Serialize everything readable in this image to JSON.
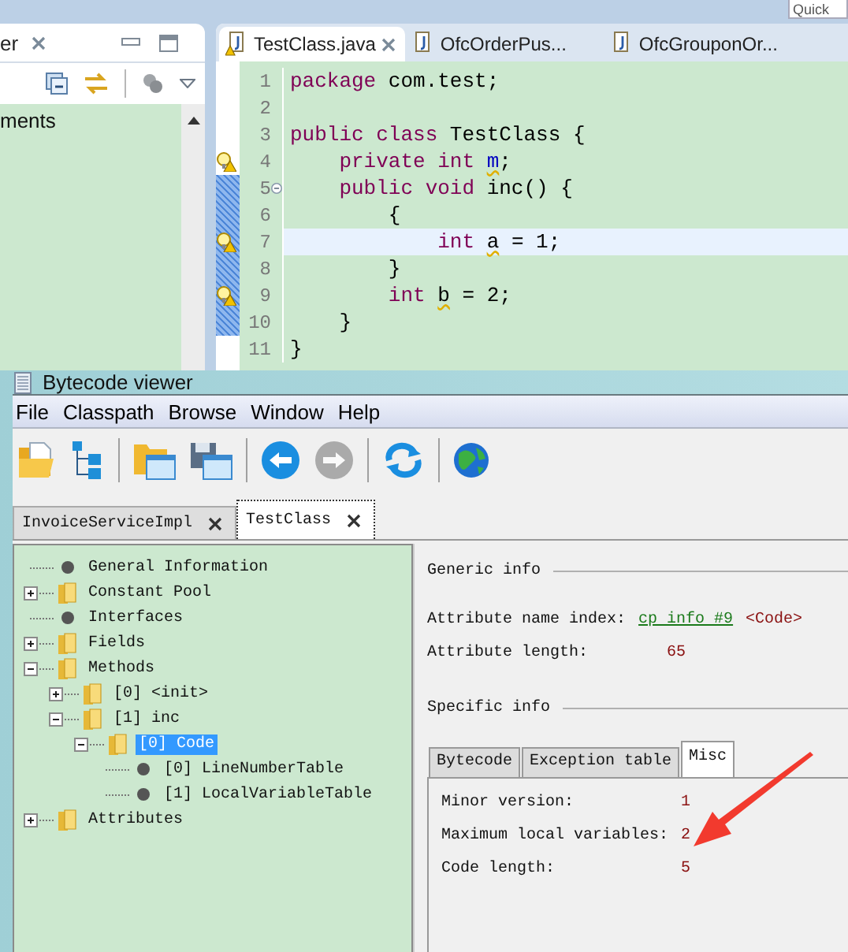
{
  "ide": {
    "quick_access": {
      "placeholder": "Quick"
    },
    "side_view": {
      "tab": {
        "label": "er"
      },
      "items": [
        "ments"
      ]
    },
    "editor_tabs": [
      {
        "label": "TestClass.java",
        "selected": true,
        "warning": true
      },
      {
        "label": "OfcOrderPus...",
        "selected": false,
        "warning": false
      },
      {
        "label": "OfcGrouponOr...",
        "selected": false,
        "warning": false
      }
    ],
    "code_lines": [
      {
        "number": "1",
        "warning": false,
        "changed": false,
        "current": false,
        "foldable": false,
        "tokens": [
          {
            "text": "package",
            "kind": "keyword"
          },
          {
            "text": " com.test;",
            "kind": "plain"
          }
        ]
      },
      {
        "number": "2",
        "warning": false,
        "changed": false,
        "current": false,
        "foldable": false
      },
      {
        "number": "3",
        "warning": false,
        "changed": false,
        "current": false,
        "foldable": false,
        "tokens": [
          {
            "text": "public class",
            "kind": "keyword"
          },
          {
            "text": " TestClass {",
            "kind": "plain"
          }
        ]
      },
      {
        "number": "4",
        "warning": true,
        "changed": false,
        "current": false,
        "foldable": false,
        "tokens": [
          {
            "text": "    private int ",
            "kind": "keyword"
          },
          {
            "text": "m",
            "kind": "field"
          },
          {
            "text": ";",
            "kind": "plain"
          }
        ]
      },
      {
        "number": "5",
        "warning": false,
        "changed": true,
        "current": false,
        "foldable": true,
        "tokens": [
          {
            "text": "    public void",
            "kind": "keyword"
          },
          {
            "text": " inc() {",
            "kind": "plain"
          }
        ]
      },
      {
        "number": "6",
        "warning": false,
        "changed": true,
        "current": false,
        "foldable": false,
        "tokens": [
          {
            "text": "        {",
            "kind": "plain"
          }
        ]
      },
      {
        "number": "7",
        "warning": true,
        "changed": true,
        "current": true,
        "foldable": false,
        "tokens": [
          {
            "text": "            int ",
            "kind": "keyword"
          },
          {
            "text": "a",
            "kind": "unused"
          },
          {
            "text": " = 1;",
            "kind": "plain"
          }
        ]
      },
      {
        "number": "8",
        "warning": false,
        "changed": true,
        "current": false,
        "foldable": false,
        "tokens": [
          {
            "text": "        }",
            "kind": "plain"
          }
        ]
      },
      {
        "number": "9",
        "warning": true,
        "changed": true,
        "current": false,
        "foldable": false,
        "tokens": [
          {
            "text": "        int ",
            "kind": "keyword"
          },
          {
            "text": "b",
            "kind": "unused"
          },
          {
            "text": " = 2;",
            "kind": "plain"
          }
        ]
      },
      {
        "number": "10",
        "warning": false,
        "changed": true,
        "current": false,
        "foldable": false,
        "tokens": [
          {
            "text": "    }",
            "kind": "plain"
          }
        ]
      },
      {
        "number": "11",
        "warning": false,
        "changed": false,
        "current": false,
        "foldable": false,
        "tokens": [
          {
            "text": "}",
            "kind": "plain"
          }
        ]
      }
    ]
  },
  "viewer": {
    "title": "Bytecode viewer",
    "menu": [
      "File",
      "Classpath",
      "Browse",
      "Window",
      "Help"
    ],
    "toolbar": [
      {
        "kind": "open",
        "disabled": false
      },
      {
        "kind": "hierarchy",
        "disabled": false
      },
      {
        "kind": "separator"
      },
      {
        "kind": "folder-window",
        "disabled": false
      },
      {
        "kind": "save-window",
        "disabled": false
      },
      {
        "kind": "separator"
      },
      {
        "kind": "back",
        "disabled": false
      },
      {
        "kind": "forward",
        "disabled": true
      },
      {
        "kind": "separator"
      },
      {
        "kind": "refresh",
        "disabled": false
      },
      {
        "kind": "separator"
      },
      {
        "kind": "globe",
        "disabled": false
      }
    ],
    "tabs": [
      {
        "label": "InvoiceServiceImpl",
        "selected": false
      },
      {
        "label": "TestClass",
        "selected": true
      }
    ],
    "tree": [
      {
        "label": "General Information",
        "kind": "leaf",
        "selected": false
      },
      {
        "label": "Constant Pool",
        "kind": "folder",
        "expanded": false,
        "selected": false
      },
      {
        "label": "Interfaces",
        "kind": "leaf",
        "selected": false
      },
      {
        "label": "Fields",
        "kind": "folder",
        "expanded": false,
        "selected": false
      },
      {
        "label": "Methods",
        "kind": "folder",
        "expanded": true,
        "selected": false,
        "children": [
          {
            "label": "[0] <init>",
            "kind": "folder",
            "expanded": false,
            "selected": false
          },
          {
            "label": "[1] inc",
            "kind": "folder",
            "expanded": true,
            "selected": false,
            "children": [
              {
                "label": "[0] Code",
                "kind": "folder",
                "expanded": true,
                "selected": true,
                "children": [
                  {
                    "label": "[0] LineNumberTable",
                    "kind": "leaf",
                    "selected": false
                  },
                  {
                    "label": "[1] LocalVariableTable",
                    "kind": "leaf",
                    "selected": false
                  }
                ]
              }
            ]
          }
        ]
      },
      {
        "label": "Attributes",
        "kind": "folder",
        "expanded": false,
        "selected": false
      }
    ],
    "generic_info": {
      "title": "Generic info",
      "rows": [
        {
          "label": "Attribute name index:",
          "link": "cp info #9",
          "value": "<Code>"
        },
        {
          "label": "Attribute length:",
          "value": "65"
        }
      ]
    },
    "specific_info": {
      "title": "Specific info",
      "tabs": [
        {
          "label": "Bytecode",
          "selected": false
        },
        {
          "label": "Exception table",
          "selected": false
        },
        {
          "label": "Misc",
          "selected": true
        }
      ],
      "rows": [
        {
          "label": "Minor version:",
          "value": "1"
        },
        {
          "label": "Maximum local variables:",
          "value": "2"
        },
        {
          "label": "Code length:",
          "value": "5"
        }
      ]
    }
  }
}
